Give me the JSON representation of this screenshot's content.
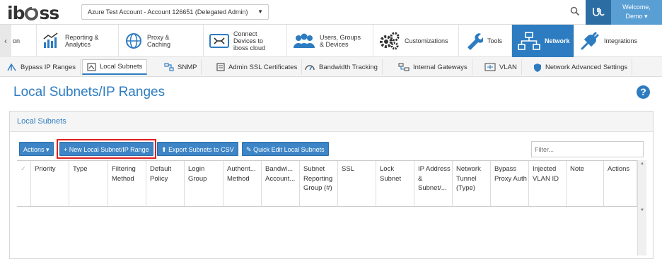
{
  "logo": "iboss",
  "account": {
    "label": "Azure Test Account - Account 126651 (Delegated Admin)"
  },
  "user": {
    "initials": "Ш",
    "welcome": "Welcome,",
    "name": "Demo"
  },
  "main_nav": [
    {
      "label": "on"
    },
    {
      "label": "Reporting &\nAnalytics"
    },
    {
      "label": "Proxy &\nCaching"
    },
    {
      "label": "Connect\nDevices to\niboss cloud"
    },
    {
      "label": "Users, Groups\n& Devices"
    },
    {
      "label": "Customizations"
    },
    {
      "label": "Tools"
    },
    {
      "label": "Network"
    },
    {
      "label": "Integrations"
    }
  ],
  "sub_nav": [
    {
      "label": "Bypass IP Ranges"
    },
    {
      "label": "Local Subnets"
    },
    {
      "label": "SNMP"
    },
    {
      "label": "Admin SSL Certificates"
    },
    {
      "label": "Bandwidth Tracking"
    },
    {
      "label": "Internal Gateways"
    },
    {
      "label": "VLAN"
    },
    {
      "label": "Network Advanced Settings"
    }
  ],
  "page": {
    "title": "Local Subnets/IP Ranges",
    "help": "?"
  },
  "panel": {
    "title": "Local Subnets"
  },
  "toolbar": {
    "actions": "Actions ▾",
    "new_subnet": "+ New Local Subnet/IP Range",
    "export": "Export Subnets to CSV",
    "quick_edit": "Quick Edit Local Subnets",
    "filter_placeholder": "Filter..."
  },
  "columns": [
    "Priority",
    "Type",
    "Filtering Method",
    "Default Policy",
    "Login Group",
    "Authent... Method",
    "Bandwi... Account...",
    "Subnet Reporting Group (#)",
    "SSL",
    "Lock Subnet",
    "IP Address & Subnet/...",
    "Network Tunnel (Type)",
    "Bypass Proxy Auth",
    "Injected VLAN ID",
    "Note",
    "Actions"
  ],
  "colors": {
    "accent": "#2d7cc1",
    "highlight": "#e02020"
  }
}
